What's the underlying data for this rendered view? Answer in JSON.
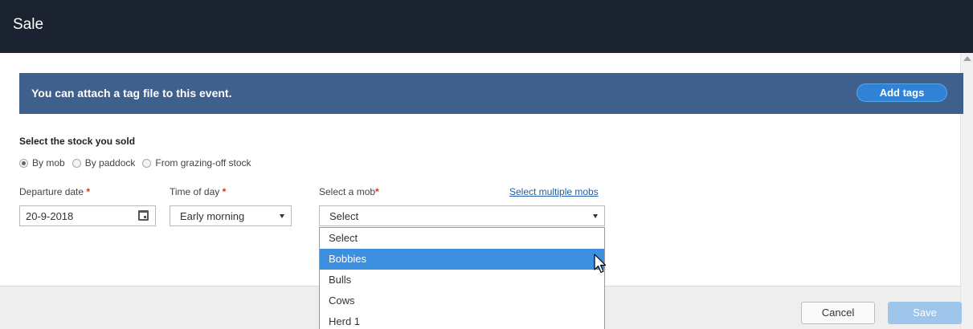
{
  "header": {
    "title": "Sale"
  },
  "banner": {
    "text": "You can attach a tag file to this event.",
    "button_label": "Add tags"
  },
  "stock": {
    "section_label": "Select the stock you sold",
    "options": [
      "By mob",
      "By paddock",
      "From grazing-off stock"
    ],
    "selected": "By mob"
  },
  "departure": {
    "label": "Departure date",
    "required_mark": "*",
    "value": "20-9-2018"
  },
  "time_of_day": {
    "label": "Time of day",
    "required_mark": "*",
    "value": "Early morning"
  },
  "mob": {
    "label": "Select a mob",
    "required_mark": "*",
    "multi_link": "Select multiple mobs",
    "value": "Select",
    "options": [
      "Select",
      "Bobbies",
      "Bulls",
      "Cows",
      "Herd 1"
    ],
    "highlighted": "Bobbies"
  },
  "footer": {
    "cancel_label": "Cancel",
    "save_label": "Save"
  },
  "colors": {
    "header_bg": "#1b2330",
    "banner_bg": "#3f5f8c",
    "accent": "#2f82d6",
    "highlight": "#3d8fe0",
    "save_disabled": "#9fc6ea",
    "required": "#c0392b"
  }
}
